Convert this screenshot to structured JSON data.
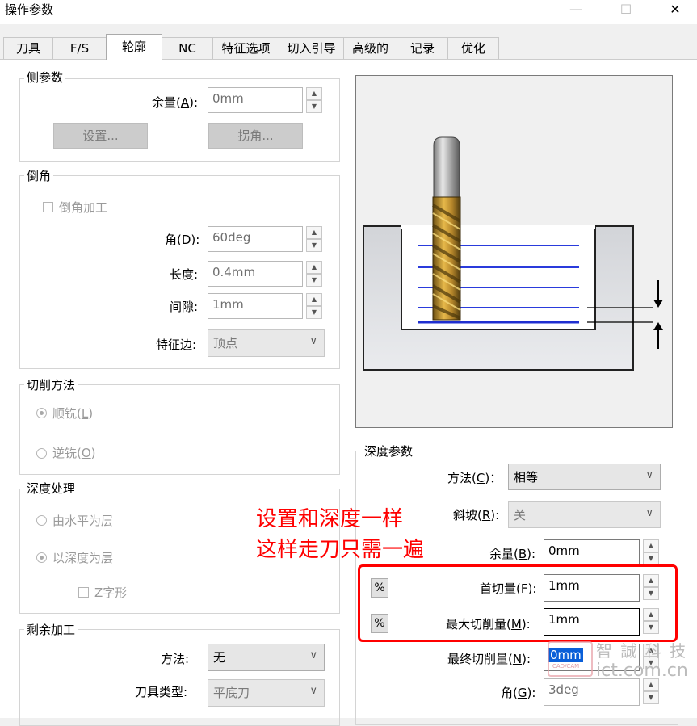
{
  "window": {
    "title": "操作参数",
    "minimize_glyph": "—",
    "maximize_glyph": "☐",
    "close_glyph": "✕"
  },
  "tabs": [
    {
      "label": "刀具",
      "active": false
    },
    {
      "label": "F/S",
      "active": false
    },
    {
      "label": "轮廓",
      "active": true
    },
    {
      "label": "NC",
      "active": false
    },
    {
      "label": "特征选项",
      "active": false
    },
    {
      "label": "切入引导",
      "active": false
    },
    {
      "label": "高级的",
      "active": false
    },
    {
      "label": "记录",
      "active": false
    },
    {
      "label": "优化",
      "active": false
    }
  ],
  "side_params": {
    "title": "侧参数",
    "allowance_label": "余量(A):",
    "allowance_label_plain": "余量(",
    "allowance_key": "A",
    "allowance_label_end": "):",
    "allowance_value": "0mm",
    "settings_button": "设置...",
    "corner_button": "拐角..."
  },
  "chamfer": {
    "title": "倒角",
    "checkbox_label": "倒角加工",
    "angle_label_pre": "角(",
    "angle_key": "D",
    "angle_label_end": "):",
    "angle_value": "60deg",
    "length_label": "长度:",
    "length_value": "0.4mm",
    "gap_label": "间隙:",
    "gap_value": "1mm",
    "edge_label": "特征边:",
    "edge_value": "顶点"
  },
  "cut_method": {
    "title": "切削方法",
    "climb_pre": "顺铣(",
    "climb_key": "L",
    "climb_end": ")",
    "conventional_pre": "逆铣(",
    "conventional_key": "O",
    "conventional_end": ")"
  },
  "depth_processing": {
    "title": "深度处理",
    "by_level": "由水平为层",
    "by_depth": "以深度为层",
    "zigzag": "Z字形"
  },
  "rest_machining": {
    "title": "剩余加工",
    "method_label": "方法:",
    "method_value": "无",
    "tool_type_label": "刀具类型:",
    "tool_type_value": "平底刀"
  },
  "depth_params": {
    "title": "深度参数",
    "method_label_pre": "方法(",
    "method_key": "C",
    "method_label_end": ")：",
    "method_value": "相等",
    "ramp_label_pre": "斜坡(",
    "ramp_key": "R",
    "ramp_label_end": "):",
    "ramp_value": "关",
    "allowance_label_pre": "余量(",
    "allowance_key": "B",
    "allowance_label_end": "):",
    "allowance_value": "0mm",
    "first_cut_label_pre": "首切量(",
    "first_cut_key": "F",
    "first_cut_label_end": "):",
    "first_cut_value": "1mm",
    "max_cut_label_pre": "最大切削量(",
    "max_cut_key": "M",
    "max_cut_label_end": "):",
    "max_cut_value": "1mm",
    "final_cut_label_pre": "最终切削量(",
    "final_cut_key": "N",
    "final_cut_label_end": "):",
    "final_cut_value": "0mm",
    "angle_label_pre": "角(",
    "angle_key": "G",
    "angle_label_end": "):",
    "angle_value": "3deg",
    "percent_symbol": "%"
  },
  "annotation": {
    "line1": "设置和深度一样",
    "line2": "这样走刀只需一遍",
    "color": "#ff0000"
  },
  "watermark": {
    "brand": "智 誠 科 技",
    "url": "ict.com.cn",
    "logo_text": "CAD/CAM"
  }
}
